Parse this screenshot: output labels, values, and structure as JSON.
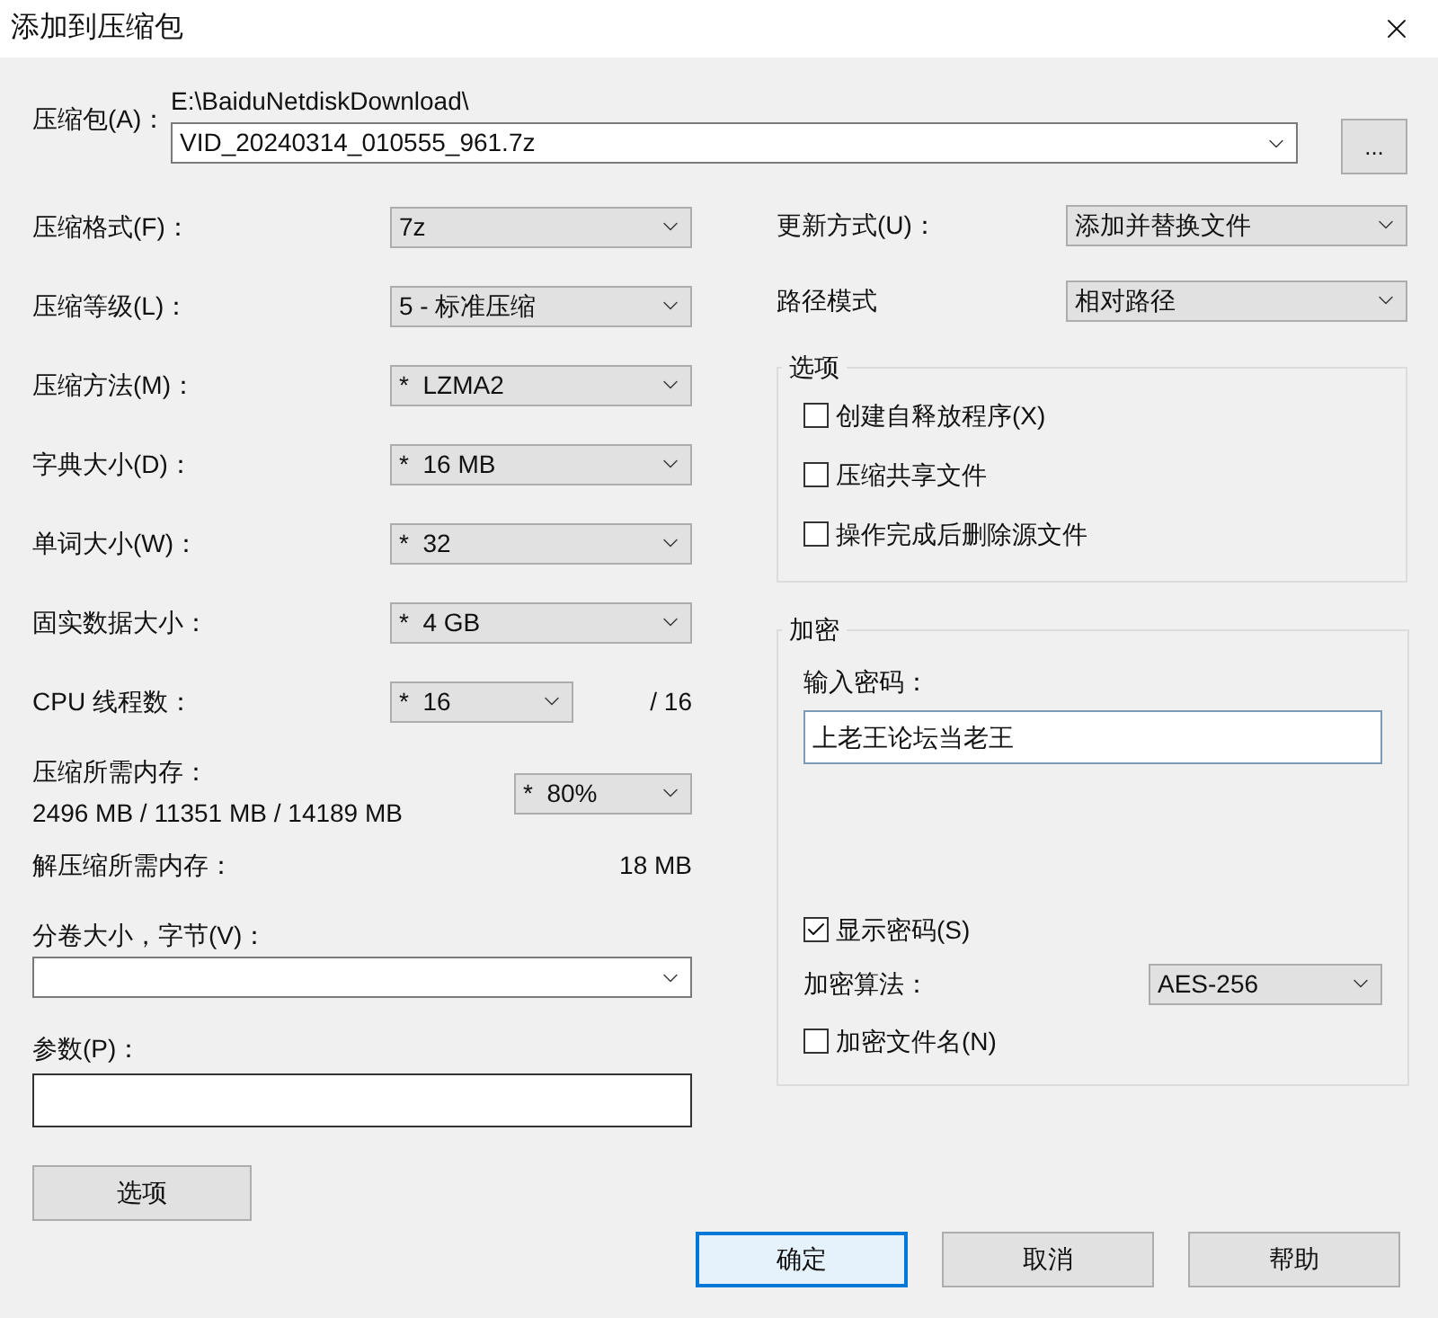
{
  "window": {
    "title": "添加到压缩包"
  },
  "archive": {
    "label": "压缩包(A)：",
    "path": "E:\\BaiduNetdiskDownload\\",
    "value": "VID_20240314_010555_961.7z",
    "browse_label": "..."
  },
  "settings": [
    {
      "kind": "select",
      "label": "压缩格式(F)：",
      "value": "7z"
    },
    {
      "kind": "select",
      "label": "压缩等级(L)：",
      "value": "5 - 标准压缩"
    },
    {
      "kind": "select",
      "label": "压缩方法(M)：",
      "value": "*  LZMA2"
    },
    {
      "kind": "select",
      "label": "字典大小(D)：",
      "value": "*  16 MB"
    },
    {
      "kind": "select",
      "label": "单词大小(W)：",
      "value": "*  32"
    },
    {
      "kind": "select",
      "label": "固实数据大小：",
      "value": "*  4 GB"
    },
    {
      "kind": "select_suffix",
      "label": "CPU 线程数：",
      "value": "*  16",
      "suffix": "/ 16"
    },
    {
      "kind": "memory",
      "label": "压缩所需内存：",
      "reading": "2496 MB / 11351 MB / 14189 MB",
      "value": "*  80%"
    },
    {
      "kind": "info",
      "label": "解压缩所需内存：",
      "reading": "18 MB"
    }
  ],
  "volume": {
    "label": "分卷大小，字节(V)："
  },
  "parameters": {
    "label": "参数(P)："
  },
  "options_button": "选项",
  "update_mode": {
    "label": "更新方式(U)：",
    "value": "添加并替换文件"
  },
  "path_mode": {
    "label": "路径模式",
    "value": "相对路径"
  },
  "options": {
    "title": "选项",
    "items": [
      {
        "label": "创建自释放程序(X)",
        "checked": false
      },
      {
        "label": "压缩共享文件",
        "checked": false
      },
      {
        "label": "操作完成后删除源文件",
        "checked": false
      }
    ]
  },
  "encryption": {
    "title": "加密",
    "password_label": "输入密码：",
    "password": "上老王论坛当老王",
    "show_password": {
      "label": "显示密码(S)",
      "checked": true
    },
    "method_label": "加密算法：",
    "method": "AES-256",
    "encrypt_names": {
      "label": "加密文件名(N)",
      "checked": false
    }
  },
  "buttons": [
    {
      "label": "确定",
      "focused": true
    },
    {
      "label": "取消",
      "focused": false
    },
    {
      "label": "帮助",
      "focused": false
    }
  ]
}
